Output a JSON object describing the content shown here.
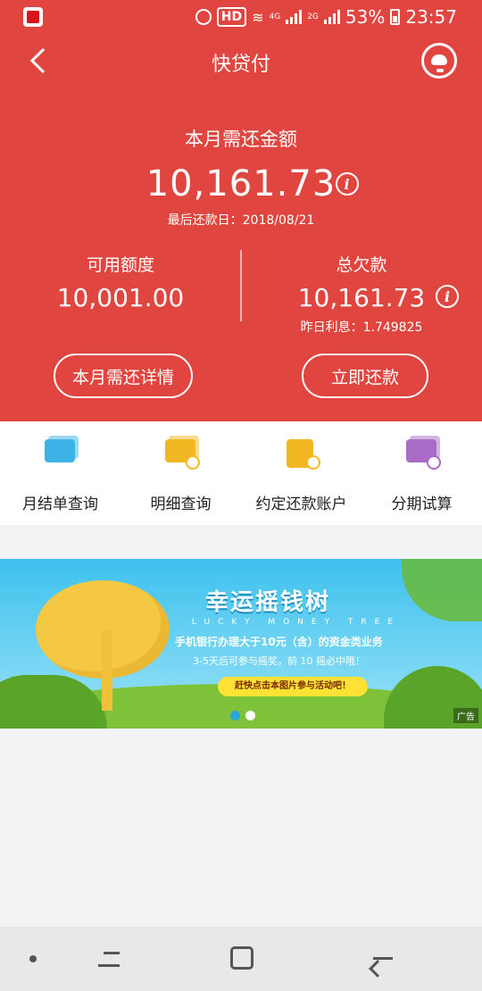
{
  "status_bar": {
    "hd": "HD",
    "net": "4G",
    "net2": "2G",
    "battery": "53%",
    "time": "23:57"
  },
  "nav": {
    "title": "快贷付"
  },
  "summary": {
    "month_label": "本月需还金额",
    "month_amount": "10,161.73",
    "last_date": "最后还款日：2018/08/21",
    "available_label": "可用额度",
    "available_value": "10,001.00",
    "total_label": "总欠款",
    "total_value": "10,161.73",
    "yesterday_interest": "昨日利息：1.749825"
  },
  "actions": {
    "detail": "本月需还详情",
    "repay": "立即还款"
  },
  "quick_items": [
    {
      "label": "月结单查询",
      "color": "#3cb2e6"
    },
    {
      "label": "明细查询",
      "color": "#f2b824"
    },
    {
      "label": "约定还款账户",
      "color": "#f2b824"
    },
    {
      "label": "分期试算",
      "color": "#a86bc6"
    }
  ],
  "banner": {
    "title": "幸运摇钱树",
    "subtitle_en": "LUCKY MONEY TREE",
    "line1": "手机银行办理大于10元（含）的资金类业务",
    "line2": "3-5天后可参与摇奖，前 10 摇必中哦！",
    "button": "赶快点击本图片参与活动吧！",
    "ad": "广告"
  },
  "colors": {
    "primary": "#e0463f",
    "background": "#f2f3f5"
  }
}
